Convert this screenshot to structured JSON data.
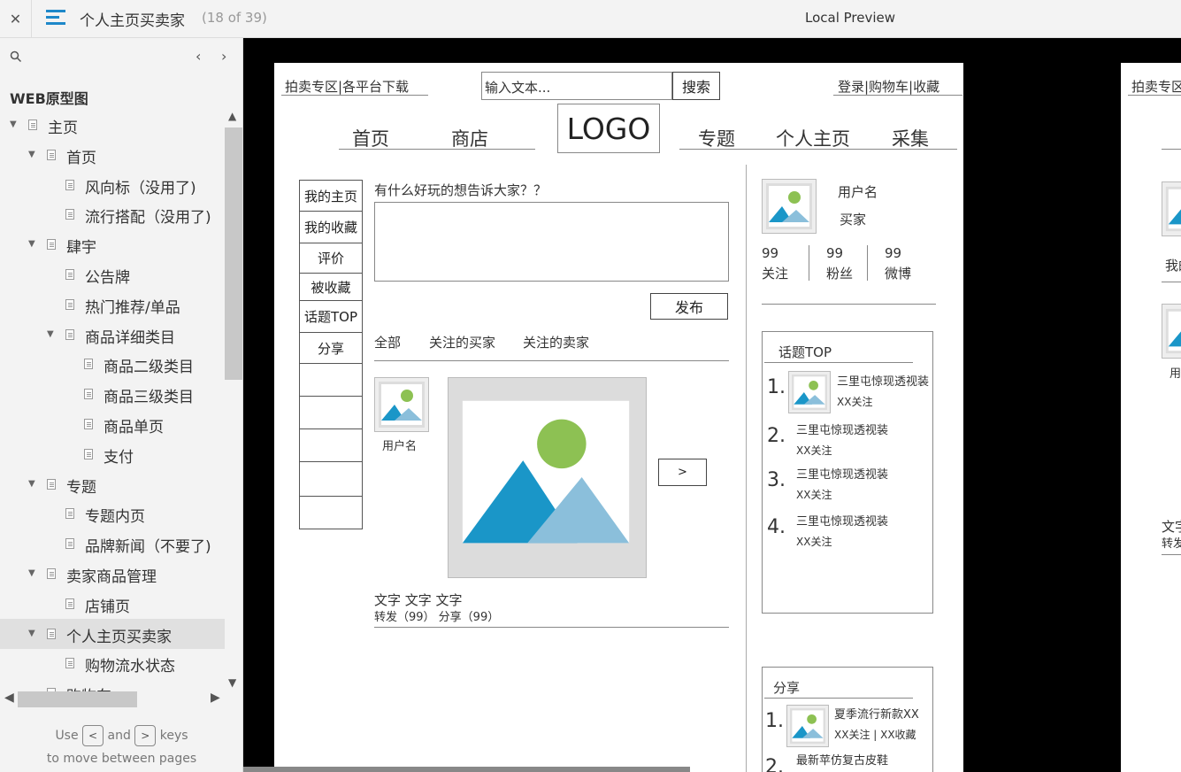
{
  "topbar": {
    "close_icon": "close-icon",
    "menu_icon": "hamburger-icon",
    "title": "个人主页买卖家",
    "count": "(18 of 39)",
    "preview_label": "Local Preview"
  },
  "sidebar": {
    "search_icon": "search-icon",
    "prev": "‹",
    "next": "›",
    "root_label": "WEB原型图",
    "items": [
      {
        "label": "主页",
        "level": 0,
        "expanded": true
      },
      {
        "label": "首页",
        "level": 1,
        "expanded": true
      },
      {
        "label": "风向标（没用了)",
        "level": 2
      },
      {
        "label": "流行搭配（没用了)",
        "level": 2
      },
      {
        "label": "肆宇",
        "level": 1,
        "expanded": true
      },
      {
        "label": "公告牌",
        "level": 2
      },
      {
        "label": "热门推荐/单品",
        "level": 2
      },
      {
        "label": "商品详细类目",
        "level": 2,
        "expanded": true
      },
      {
        "label": "商品二级类目",
        "level": 3
      },
      {
        "label": "商品三级类目",
        "level": 3
      },
      {
        "label": "商品单页",
        "level": 3
      },
      {
        "label": "支付",
        "level": 3
      },
      {
        "label": "专题",
        "level": 1,
        "expanded": true
      },
      {
        "label": "专题内页",
        "level": 2
      },
      {
        "label": "品牌新闻（不要了)",
        "level": 2
      },
      {
        "label": "卖家商品管理",
        "level": 1,
        "expanded": true
      },
      {
        "label": "店铺页",
        "level": 2
      },
      {
        "label": "个人主页买卖家",
        "level": 1,
        "expanded": true,
        "selected": true
      },
      {
        "label": "购物流水状态",
        "level": 2
      },
      {
        "label": "购物车",
        "level": 1
      }
    ],
    "hint_use": "Use",
    "hint_and": "and",
    "hint_keys": "keys",
    "hint_line2": "to move between pages",
    "key_prev": "<",
    "key_next": ">"
  },
  "wireframe": {
    "top_links_left": "拍卖专区|各平台下载",
    "search_placeholder": "输入文本...",
    "search_button": "搜索",
    "top_links_right": "登录|购物车|收藏",
    "nav_home": "首页",
    "nav_shop": "商店",
    "logo": "LOGO",
    "nav_topic": "专题",
    "nav_profile": "个人主页",
    "nav_collect": "采集",
    "left_tabs": [
      "我的主页",
      "我的收藏",
      "评价",
      "被收藏",
      "话题TOP",
      "分享",
      "",
      "",
      "",
      "",
      ""
    ],
    "post_prompt": "有什么好玩的想告诉大家？？",
    "publish_button": "发布",
    "feed_tabs": [
      "全部",
      "关注的买家",
      "关注的卖家"
    ],
    "feed_username": "用户名",
    "feed_next": ">",
    "feed_text": "文字 文字 文字",
    "feed_meta": "转发（99）  分享（99）",
    "profile_name": "用户名",
    "profile_role": "买家",
    "stats": [
      {
        "num": "99",
        "label": "关注"
      },
      {
        "num": "99",
        "label": "粉丝"
      },
      {
        "num": "99",
        "label": "微博"
      }
    ],
    "topic_title": "话题TOP",
    "topics": [
      {
        "rank": "1.",
        "name": "三里屯惊现透视装",
        "follow": "XX关注"
      },
      {
        "rank": "2.",
        "name": "三里屯惊现透视装",
        "follow": "XX关注"
      },
      {
        "rank": "3.",
        "name": "三里屯惊现透视装",
        "follow": "XX关注"
      },
      {
        "rank": "4.",
        "name": "三里屯惊现透视装",
        "follow": "XX关注"
      }
    ],
    "share_title": "分享",
    "shares": [
      {
        "rank": "1.",
        "name": "夏季流行新款XX",
        "meta": "XX关注 |  XX收藏"
      },
      {
        "rank": "2.",
        "name": "最新苹仿复古皮鞋",
        "meta": ""
      }
    ]
  },
  "page2": {
    "top_link": "拍卖专区",
    "tab_partial": "我的",
    "user_partial": "用",
    "text_partial_1": "文字",
    "text_partial_2": "转发"
  },
  "colors": {
    "accent": "#1e88c9",
    "img_sky": "#1a96c8",
    "img_sky_light": "#8bbfdb",
    "img_sun": "#8dc153"
  }
}
